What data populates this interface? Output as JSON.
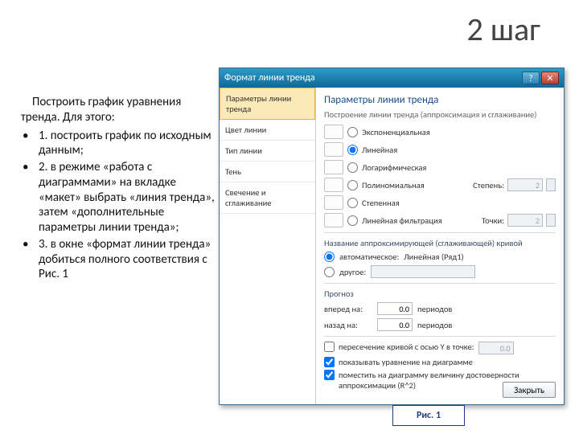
{
  "title": "2 шаг",
  "instructions": {
    "lead": "Построить график уравнения тренда. Для этого:",
    "items": [
      "1. построить график по исходным данным;",
      "2. в режиме «работа с диаграммами» на вкладке «макет» выбрать «линия тренда», затем «дополнительные параметры линии тренда»;",
      "3. в окне «формат линии тренда» добиться полного соответствия с Рис. 1"
    ]
  },
  "dialog": {
    "title": "Формат линии тренда",
    "help_btn": "?",
    "close_btn": "✕",
    "sidebar": [
      "Параметры линии тренда",
      "Цвет линии",
      "Тип линии",
      "Тень",
      "Свечение и сглаживание"
    ],
    "main": {
      "heading": "Параметры линии тренда",
      "sub": "Построение линии тренда (аппроксимация и сглаживание)",
      "types": {
        "exp": "Экспоненциальная",
        "lin": "Линейная",
        "log": "Логарифмическая",
        "pol": "Полиномиальная",
        "pol_deg_lbl": "Степень:",
        "pol_deg": "2",
        "pow": "Степенная",
        "mov": "Линейная фильтрация",
        "mov_lbl": "Точки:",
        "mov_val": "2"
      },
      "name_section": "Название аппроксимирующей (сглаживающей) кривой",
      "auto_lbl": "автоматическое:",
      "auto_val": "Линейная (Ряд1)",
      "other_lbl": "другое:",
      "forecast_heading": "Прогноз",
      "fwd_lbl": "вперед на:",
      "fwd_val": "0.0",
      "bwd_lbl": "назад на:",
      "bwd_val": "0.0",
      "units": "периодов",
      "chk_intercept": "пересечение кривой с осью Y в точке:",
      "intercept_val": "0.0",
      "chk_eq": "показывать уравнение на диаграмме",
      "chk_r2": "поместить на диаграмму величину достоверности аппроксимации (R^2)",
      "close": "Закрыть"
    }
  },
  "caption": "Рис. 1"
}
